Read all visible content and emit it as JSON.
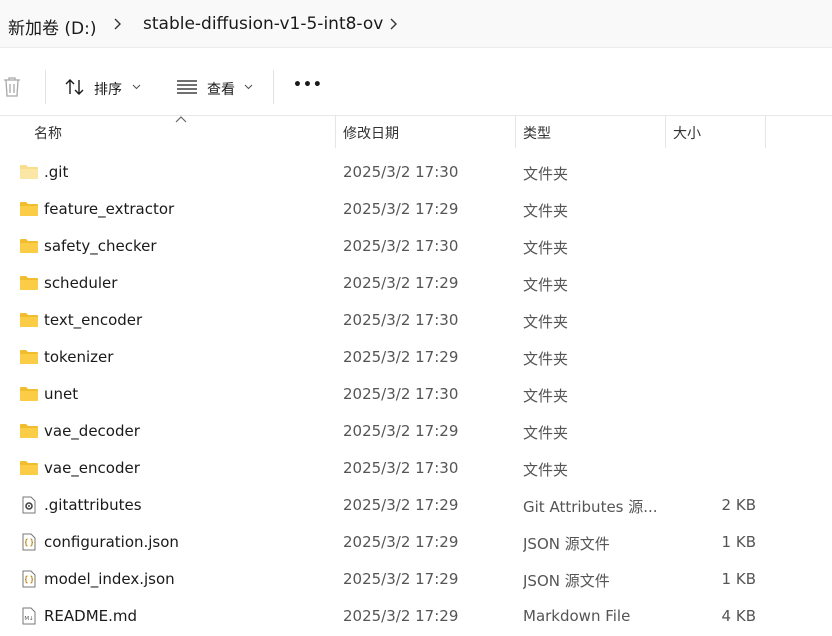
{
  "breadcrumb": {
    "drive": "新加卷 (D:)",
    "folder": "stable-diffusion-v1-5-int8-ov"
  },
  "toolbar": {
    "sort_label": "排序",
    "view_label": "查看",
    "more_label": "•••"
  },
  "columns": {
    "name": "名称",
    "modified": "修改日期",
    "type": "类型",
    "size": "大小"
  },
  "files": [
    {
      "name": ".git",
      "modified": "2025/3/2 17:30",
      "type": "文件夹",
      "size": "",
      "icon": "folder-icon",
      "light": true
    },
    {
      "name": "feature_extractor",
      "modified": "2025/3/2 17:29",
      "type": "文件夹",
      "size": "",
      "icon": "folder-icon"
    },
    {
      "name": "safety_checker",
      "modified": "2025/3/2 17:30",
      "type": "文件夹",
      "size": "",
      "icon": "folder-icon"
    },
    {
      "name": "scheduler",
      "modified": "2025/3/2 17:29",
      "type": "文件夹",
      "size": "",
      "icon": "folder-icon"
    },
    {
      "name": "text_encoder",
      "modified": "2025/3/2 17:30",
      "type": "文件夹",
      "size": "",
      "icon": "folder-icon"
    },
    {
      "name": "tokenizer",
      "modified": "2025/3/2 17:29",
      "type": "文件夹",
      "size": "",
      "icon": "folder-icon"
    },
    {
      "name": "unet",
      "modified": "2025/3/2 17:30",
      "type": "文件夹",
      "size": "",
      "icon": "folder-icon"
    },
    {
      "name": "vae_decoder",
      "modified": "2025/3/2 17:29",
      "type": "文件夹",
      "size": "",
      "icon": "folder-icon"
    },
    {
      "name": "vae_encoder",
      "modified": "2025/3/2 17:30",
      "type": "文件夹",
      "size": "",
      "icon": "folder-icon"
    },
    {
      "name": ".gitattributes",
      "modified": "2025/3/2 17:29",
      "type": "Git Attributes 源...",
      "size": "2 KB",
      "icon": "gear-file-icon"
    },
    {
      "name": "configuration.json",
      "modified": "2025/3/2 17:29",
      "type": "JSON 源文件",
      "size": "1 KB",
      "icon": "json-file-icon"
    },
    {
      "name": "model_index.json",
      "modified": "2025/3/2 17:29",
      "type": "JSON 源文件",
      "size": "1 KB",
      "icon": "json-file-icon"
    },
    {
      "name": "README.md",
      "modified": "2025/3/2 17:29",
      "type": "Markdown File",
      "size": "4 KB",
      "icon": "markdown-file-icon"
    }
  ]
}
